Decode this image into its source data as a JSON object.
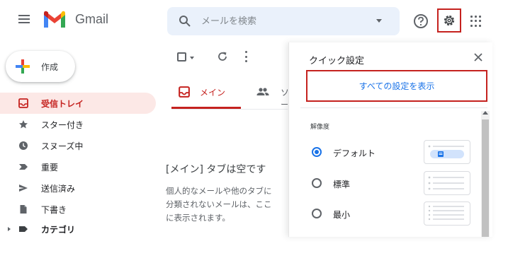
{
  "header": {
    "menu_icon": "hamburger-icon",
    "logo_icon": "gmail-m-icon",
    "logo_text": "Gmail",
    "search": {
      "placeholder": "メールを検索",
      "icon": "search-icon",
      "options_icon": "caret-down-icon"
    },
    "help_icon": "help-icon",
    "settings_icon": "gear-icon",
    "apps_icon": "apps-grid-icon"
  },
  "compose": {
    "label": "作成",
    "icon": "compose-plus-icon"
  },
  "sidebar": {
    "items": [
      {
        "label": "受信トレイ",
        "icon": "inbox-icon",
        "active": true
      },
      {
        "label": "スター付き",
        "icon": "star-icon"
      },
      {
        "label": "スヌーズ中",
        "icon": "clock-icon"
      },
      {
        "label": "重要",
        "icon": "important-icon"
      },
      {
        "label": "送信済み",
        "icon": "send-icon"
      },
      {
        "label": "下書き",
        "icon": "draft-icon"
      },
      {
        "label": "カテゴリ",
        "icon": "label-icon"
      }
    ]
  },
  "toolbar": {
    "select_icon": "checkbox-icon",
    "refresh_icon": "refresh-icon",
    "more_icon": "more-vert-icon"
  },
  "tabs": [
    {
      "label": "メイン",
      "icon": "inbox-icon",
      "active": true
    },
    {
      "label": "ソーシャル",
      "icon": "people-icon"
    }
  ],
  "main": {
    "empty_title": "[メイン] タブは空です",
    "empty_lines": [
      "個人的なメールや他のタブに",
      "分類されないメールは、ここ",
      "に表示されます。"
    ]
  },
  "quick_settings": {
    "title": "クイック設定",
    "close_icon": "close-icon",
    "all_settings_label": "すべての設定を表示",
    "density_label": "解像度",
    "options": [
      {
        "label": "デフォルト",
        "selected": true
      },
      {
        "label": "標準",
        "selected": false
      },
      {
        "label": "最小",
        "selected": false
      }
    ]
  },
  "colors": {
    "accent_red": "#c5221f",
    "link_blue": "#1a73e8",
    "active_bg": "#fce8e6",
    "search_bg": "#eaf1fb"
  }
}
